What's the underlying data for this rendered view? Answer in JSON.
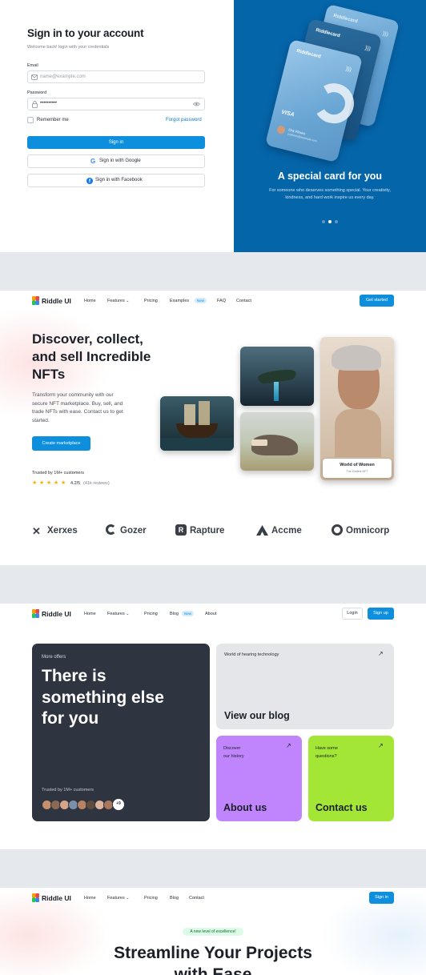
{
  "signin": {
    "title": "Sign in to your account",
    "subtitle": "Welcome back! login with your credentials",
    "email_label": "Email",
    "email_placeholder": "name@example.com",
    "password_label": "Password",
    "password_value": "••••••••••",
    "remember": "Remember me",
    "forgot": "Forgot password",
    "signin_button": "Sign in",
    "google_button": "Sign in with Google",
    "facebook_button": "Sign in with Facebook",
    "promo_title": "A special card for you",
    "promo_text": "For someone who deserves something special. Your creativity, kindness, and hard work inspire us every day.",
    "card_brand": "Riddlecard",
    "card_network": "VISA",
    "card_holder": "Ora Flores",
    "card_holder_sub": "oraflores@example.com",
    "carousel_active": 1
  },
  "nft": {
    "logo": "Riddle UI",
    "nav": {
      "home": "Home",
      "features": "Features",
      "pricing": "Pricing",
      "examples": "Examples",
      "new_badge": "New",
      "faq": "FAQ",
      "contact": "Contact",
      "cta": "Get started"
    },
    "headline_1": "Discover, collect,",
    "headline_2": "and sell Incredible",
    "headline_3": "NFTs",
    "body_1": "Transform your community with our",
    "body_2": "secure NFT marketplace. Buy, sell, and",
    "body_3": "trade NFTs with ease. Contact us to get",
    "body_4": "started.",
    "cta": "Create marketplace",
    "trusted": "Trusted by 1M+ customers",
    "rating": "4.2/5",
    "reviews": "(41k reviews)",
    "rating_stars": 5,
    "featured_title": "World of Women",
    "featured_sub": "The Kinders NFT",
    "brands": [
      "Xerxes",
      "Gozer",
      "Rapture",
      "Accme",
      "Omnicorp"
    ]
  },
  "offers": {
    "logo": "Riddle UI",
    "nav": {
      "home": "Home",
      "features": "Features",
      "pricing": "Pricing",
      "blog": "Blog",
      "new_badge": "New",
      "about": "About",
      "login": "Login",
      "signup": "Sign up"
    },
    "eyebrow": "More offers",
    "headline_1": "There is",
    "headline_2": "something else",
    "headline_3": "for you",
    "trusted": "Trusted by 1M+ customers",
    "more_count": "+9",
    "blog_eyebrow": "World of hearing technology",
    "blog_title": "View our blog",
    "about_eyebrow_1": "Discover",
    "about_eyebrow_2": "our history",
    "about_title": "About us",
    "contact_eyebrow_1": "Have some",
    "contact_eyebrow_2": "questions?",
    "contact_title": "Contact us",
    "colors": {
      "dark": "#2e3440",
      "gray": "#e4e6e9",
      "purple": "#c084fc",
      "lime": "#a3e635"
    }
  },
  "stream": {
    "logo": "Riddle UI",
    "nav": {
      "home": "Home",
      "features": "Features",
      "pricing": "Pricing",
      "blog": "Blog",
      "contact": "Contact",
      "signin": "Sign in"
    },
    "badge": "A new level of excellence!",
    "headline_1": "Streamline Your Projects",
    "headline_2": "with Ease"
  },
  "colors": {
    "primary": "#0d8fde",
    "promo_bg": "#0565a9"
  }
}
